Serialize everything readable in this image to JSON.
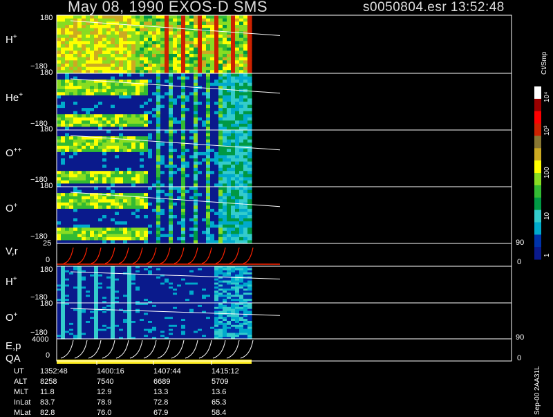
{
  "header": {
    "title_left": "May 08, 1990   EXOS-D SMS",
    "title_right": "s0050804.esr  13:52:48"
  },
  "colorbar": {
    "unit": "Ct/Smp",
    "ticks": [
      "1",
      "10",
      "100",
      "10³",
      "10⁴"
    ],
    "colors": [
      "#0a1a8c",
      "#0033aa",
      "#00aacc",
      "#33cccc",
      "#009944",
      "#33bb33",
      "#88dd22",
      "#ffff00",
      "#ccaa22",
      "#887733",
      "#cc2200",
      "#ff0000",
      "#990000",
      "#ffffff"
    ]
  },
  "panels": [
    {
      "label": "H",
      "sup": "+",
      "top_tick": "180",
      "bottom_tick": "−180"
    },
    {
      "label": "He",
      "sup": "+",
      "top_tick": "180",
      "bottom_tick": "−180"
    },
    {
      "label": "O",
      "sup": "++",
      "top_tick": "180",
      "bottom_tick": "−180"
    },
    {
      "label": "O",
      "sup": "+",
      "top_tick": "180",
      "bottom_tick": "−180"
    },
    {
      "label": "V,r",
      "sup": "",
      "top_tick": "25",
      "bottom_tick": "0",
      "right_top": "90",
      "right_bottom": "0"
    },
    {
      "label": "H",
      "sup": "+",
      "top_tick": "180",
      "bottom_tick": "−180"
    },
    {
      "label": "O",
      "sup": "+",
      "top_tick": "180",
      "bottom_tick": "−180"
    },
    {
      "label": "E,p",
      "sup": "",
      "top_tick": "4000",
      "bottom_tick": "0",
      "right_top": "90",
      "right_bottom": "0"
    }
  ],
  "qa_label": "QA",
  "table": {
    "rows": [
      {
        "name": "UT",
        "values": [
          "1352:48",
          "1400:16",
          "1407:44",
          "1415:12"
        ]
      },
      {
        "name": "ALT",
        "values": [
          "8258",
          "7540",
          "6689",
          "5709"
        ]
      },
      {
        "name": "MLT",
        "values": [
          "11.8",
          "12.9",
          "13.3",
          "13.6"
        ]
      },
      {
        "name": "InLat",
        "values": [
          "83.7",
          "78.9",
          "72.8",
          "65.3"
        ]
      },
      {
        "name": "MLat",
        "values": [
          "82.8",
          "76.0",
          "67.9",
          "58.4"
        ]
      }
    ]
  },
  "side_note": "Sep-00  2AA31L",
  "chart_data": {
    "type": "heatmap",
    "x": [
      "1352:48",
      "1400:16",
      "1407:44",
      "1415:12"
    ],
    "ylim": [
      -180,
      180
    ],
    "series": [
      {
        "name": "H+"
      },
      {
        "name": "He+"
      },
      {
        "name": "O++"
      },
      {
        "name": "O+"
      },
      {
        "name": "V,r",
        "ylim": [
          0,
          25
        ]
      },
      {
        "name": "H+"
      },
      {
        "name": "O+"
      },
      {
        "name": "E,p",
        "ylim": [
          0,
          4000
        ]
      }
    ]
  }
}
